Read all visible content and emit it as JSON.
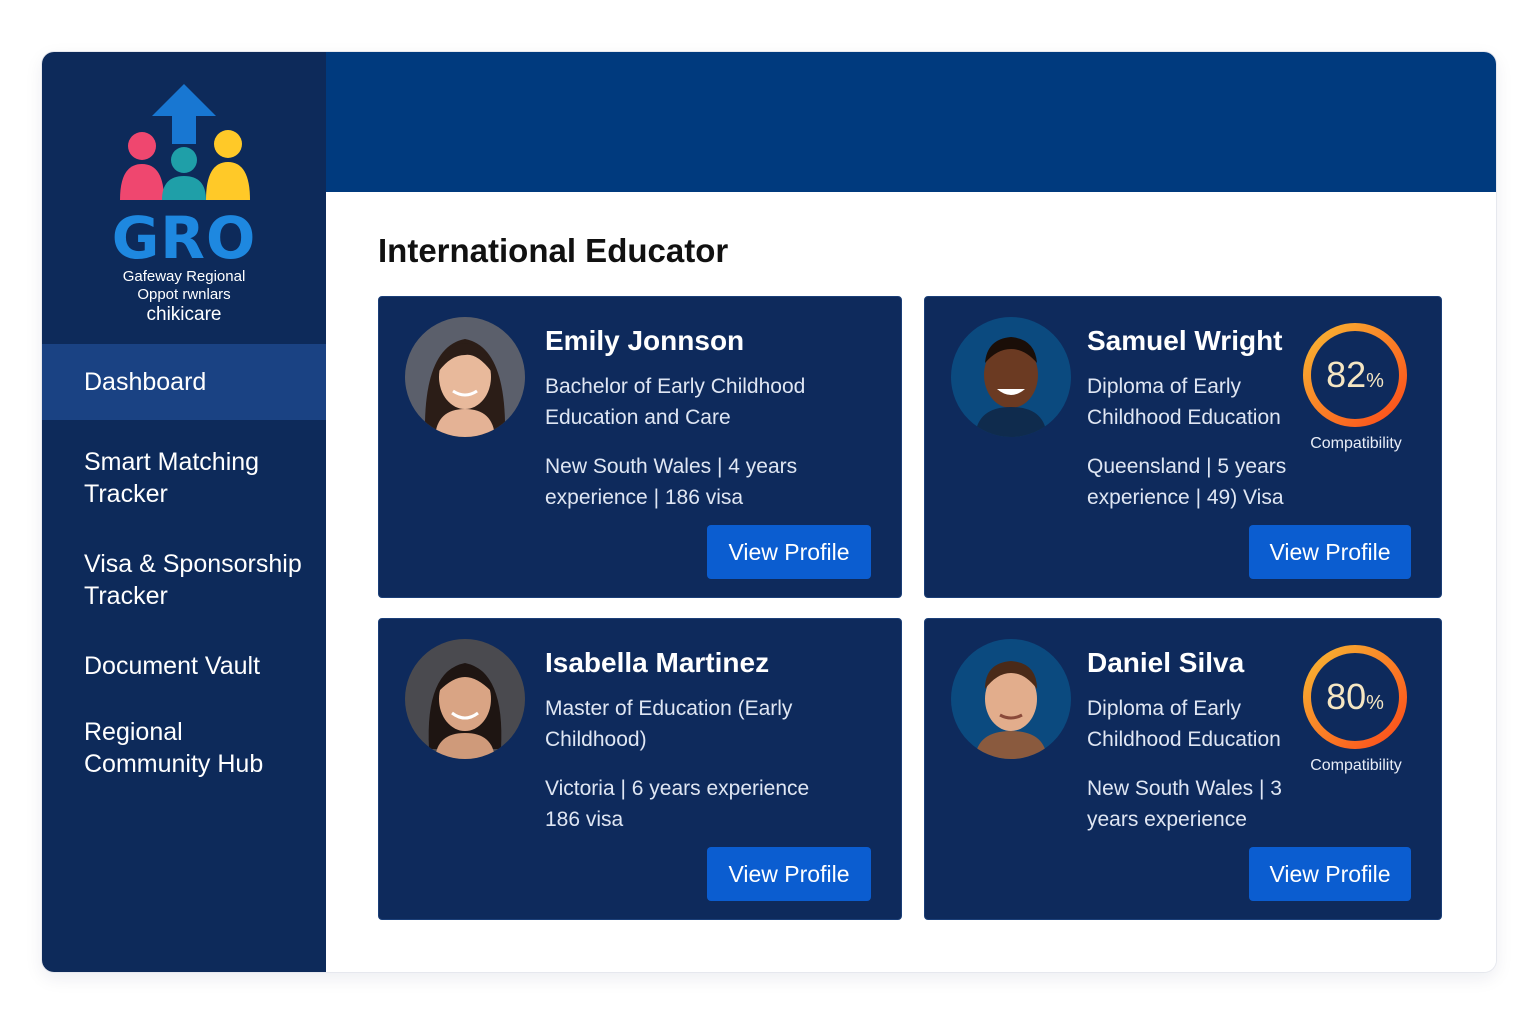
{
  "brand": {
    "short": "GRO",
    "line1": "Gafeway Regional",
    "line2": "Oppot rwnlars",
    "line3": "chikicare"
  },
  "sidebar": {
    "items": [
      {
        "label": "Dashboard",
        "active": true
      },
      {
        "label": "Smart Matching Tracker"
      },
      {
        "label": "Visa & Sponsorship Tracker"
      },
      {
        "label": "Document Vault"
      },
      {
        "label": "Regional Community Hub"
      }
    ]
  },
  "main": {
    "title": "International Educator",
    "cards": [
      {
        "name": "Emily Jonnson",
        "degree": "Bachelor of Early Childhood Education and Care",
        "meta": "New South Wales | 4 years experience | 186 visa",
        "button": "View Profile"
      },
      {
        "name": "Samuel Wright",
        "degree": "Diploma of Early Childhood Education",
        "meta": "Queensland | 5 years experience | 49) Visa",
        "button": "View Profile",
        "compatibility": {
          "value": "82",
          "unit": "%",
          "label": "Compatibility",
          "fraction": 0.82
        }
      },
      {
        "name": "Isabella Martinez",
        "degree": "Master of Education (Early Childhood)",
        "meta": "Victoria | 6 years experience 186 visa",
        "button": "View Profile"
      },
      {
        "name": "Daniel Silva",
        "degree": "Diploma of Early Childhood Education",
        "meta": "New South Wales | 3 years experience",
        "button": "View Profile",
        "compatibility": {
          "value": "80",
          "unit": "%",
          "label": "Compatibility",
          "fraction": 0.8
        }
      }
    ]
  },
  "colors": {
    "sidebar": "#0d2a5a",
    "header": "#003a7e",
    "card": "#0e2a5c",
    "button": "#0b5dd0",
    "ring_start": "#f7b733",
    "ring_end": "#fc4a1a"
  }
}
